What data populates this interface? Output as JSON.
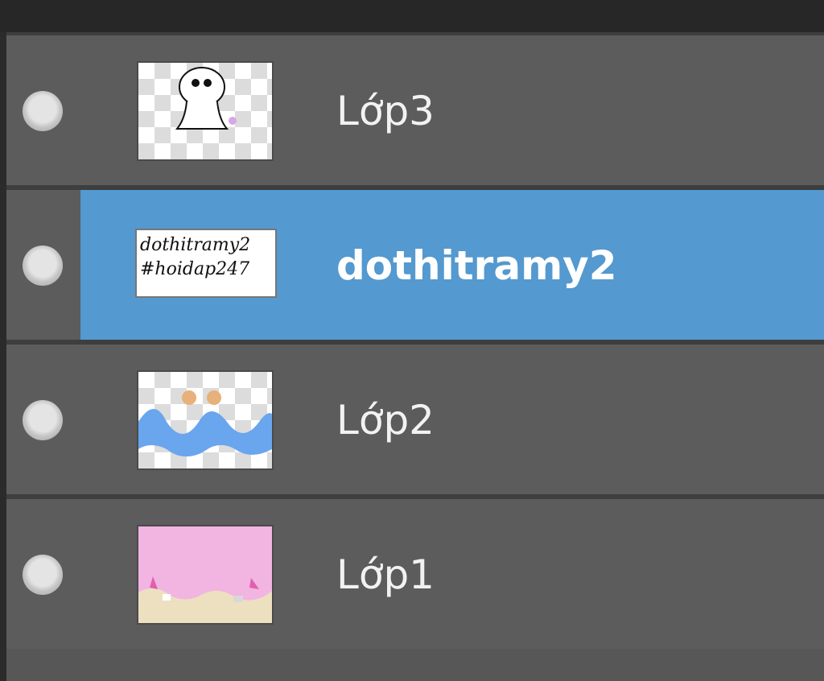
{
  "layers_panel": {
    "layers": [
      {
        "name": "Lớp3",
        "selected": false,
        "visibility_icon": "visibility-circle-icon",
        "thumbnail": "ghost-sketch"
      },
      {
        "name": "dothitramy2",
        "selected": true,
        "visibility_icon": "visibility-circle-icon",
        "thumbnail": "text-signature",
        "thumbnail_text": [
          "dothitramy2",
          "#hoidap247"
        ]
      },
      {
        "name": "Lớp2",
        "selected": false,
        "visibility_icon": "visibility-circle-icon",
        "thumbnail": "blue-waves"
      },
      {
        "name": "Lớp1",
        "selected": false,
        "visibility_icon": "visibility-circle-icon",
        "thumbnail": "pink-cream"
      }
    ],
    "colors": {
      "panel_bg": "#5c5c5c",
      "selected_bg": "#5499cf",
      "text": "#f2f2f2"
    }
  }
}
